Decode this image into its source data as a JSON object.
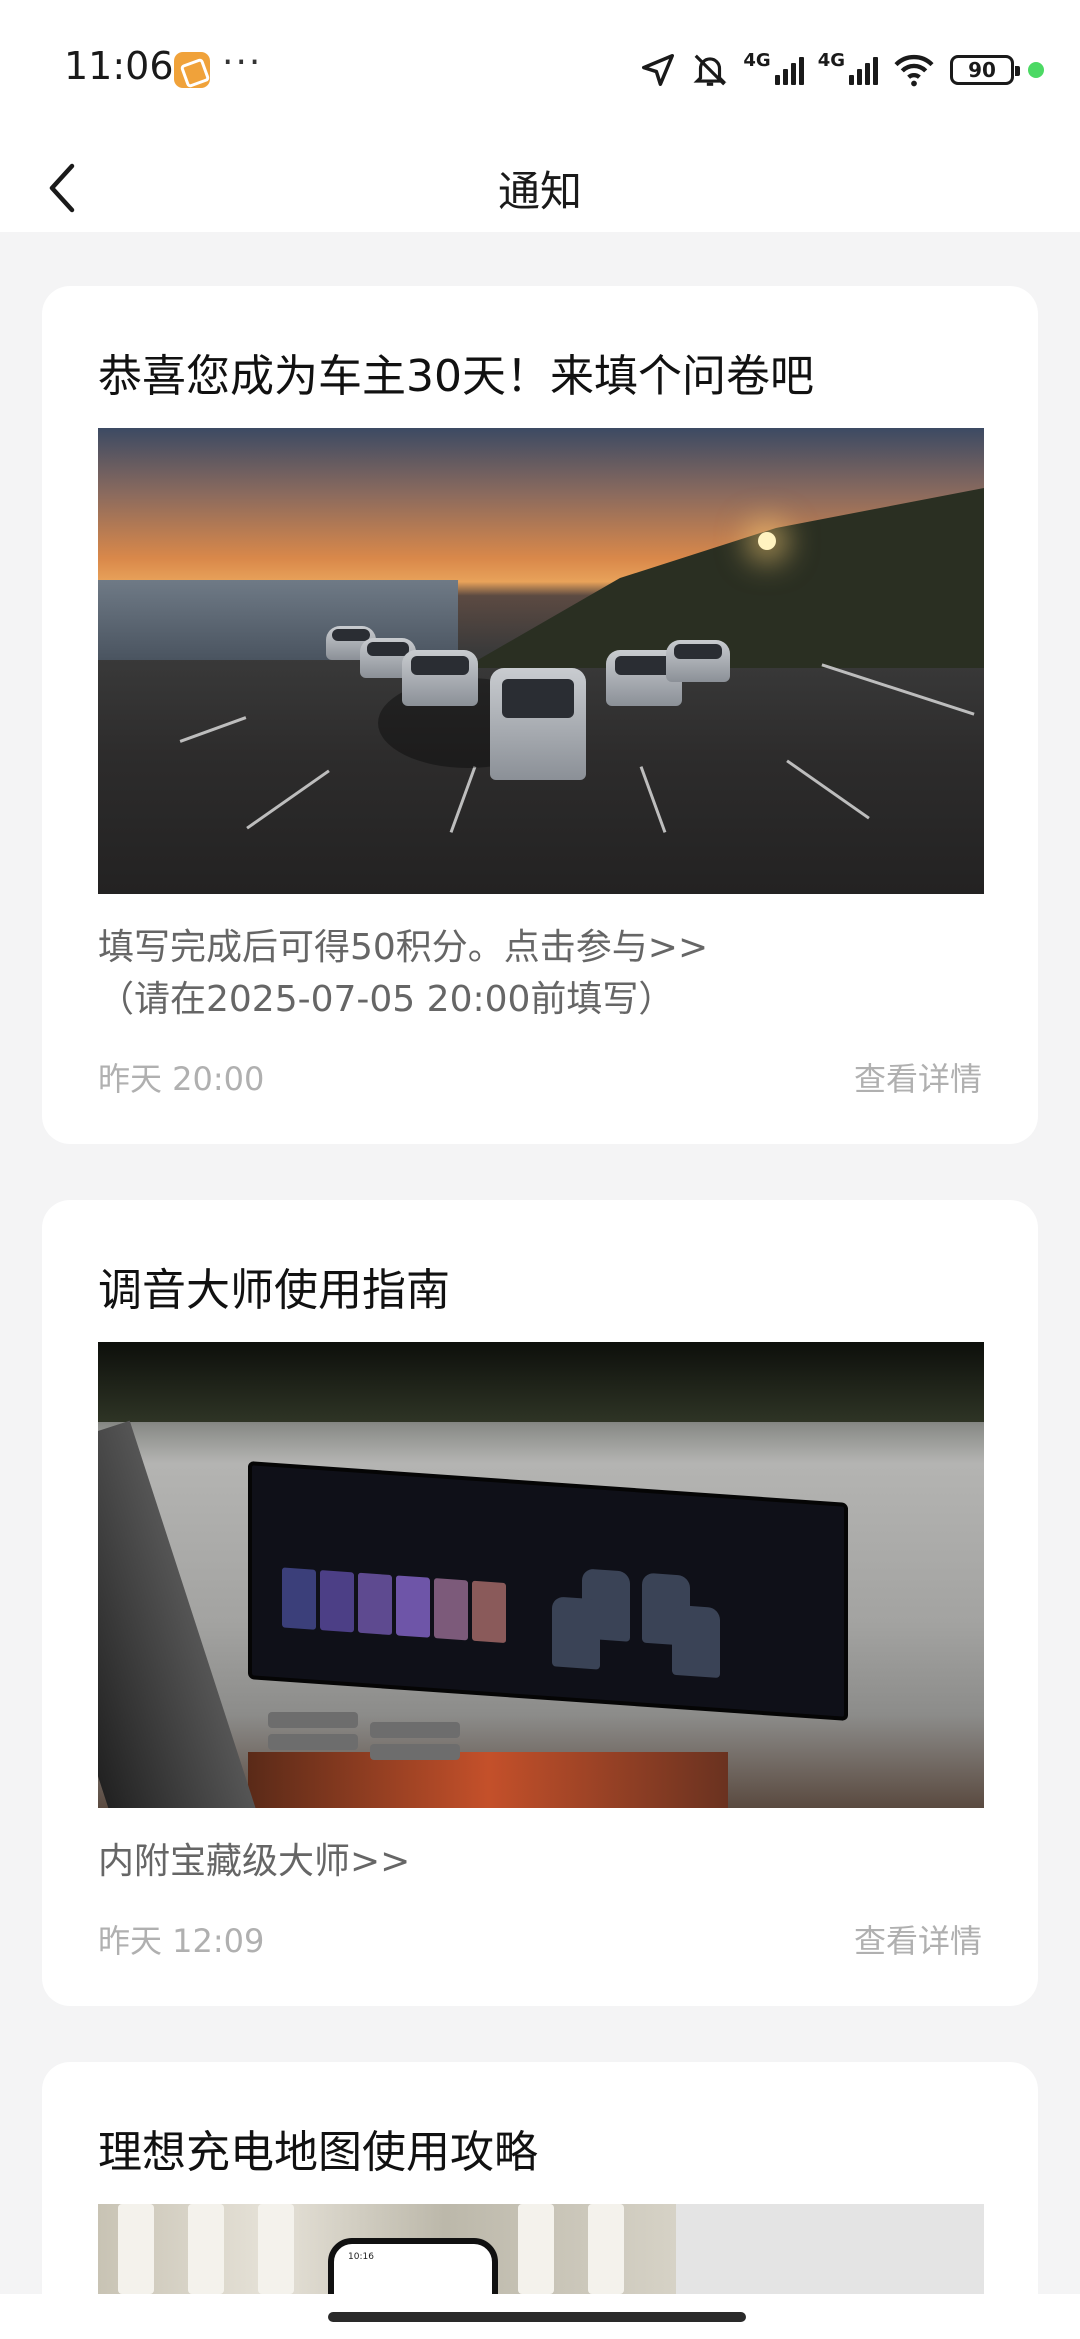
{
  "status_bar": {
    "time": "11:06",
    "more": "···",
    "net1": "4G",
    "net2": "4G",
    "battery": "90"
  },
  "header": {
    "title": "通知"
  },
  "notifications": [
    {
      "title": "恭喜您成为车主30天！来填个问卷吧",
      "desc_line1": "填写完成后可得50积分。点击参与>>",
      "desc_line2": "（请在2025-07-05 20:00前填写）",
      "time": "昨天 20:00",
      "detail": "查看详情"
    },
    {
      "title": "调音大师使用指南",
      "desc_line1": "内附宝藏级大师>>",
      "time": "昨天 12:09",
      "detail": "查看详情"
    },
    {
      "title": "理想充电地图使用攻略"
    }
  ],
  "colors": {
    "page_bg": "#f4f4f5",
    "card_bg": "#ffffff",
    "meta_text": "#b0b0b0",
    "desc_text": "#666666",
    "status_green": "#4cd964"
  }
}
